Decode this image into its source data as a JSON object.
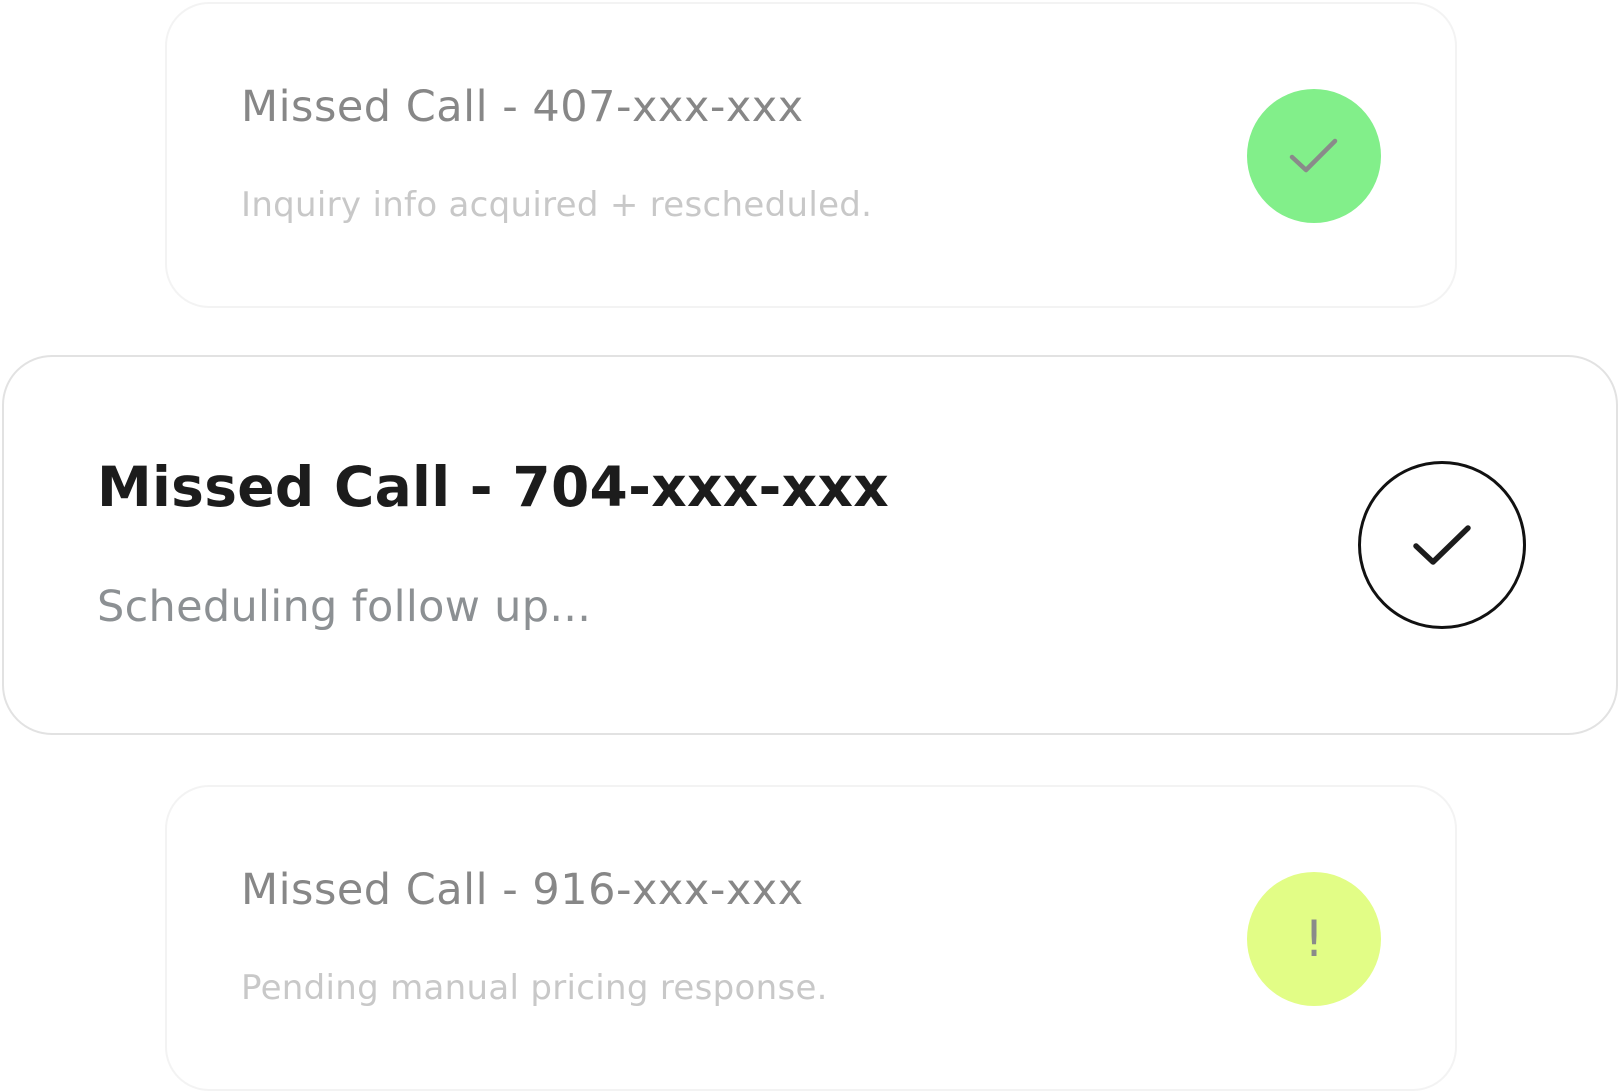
{
  "calls": [
    {
      "title": "Missed Call - 407-xxx-xxx",
      "subtitle": "Inquiry info acquired + rescheduled.",
      "status_icon": "check-icon",
      "status_color": "#82ef8a"
    },
    {
      "title": "Missed Call - 704-xxx-xxx",
      "subtitle": "Scheduling follow up...",
      "status_icon": "check-icon",
      "status_color": "#ffffff"
    },
    {
      "title": "Missed Call - 916-xxx-xxx",
      "subtitle": "Pending manual pricing response.",
      "status_icon": "alert-icon",
      "status_color": "#e2fd86",
      "status_glyph": "!"
    }
  ]
}
